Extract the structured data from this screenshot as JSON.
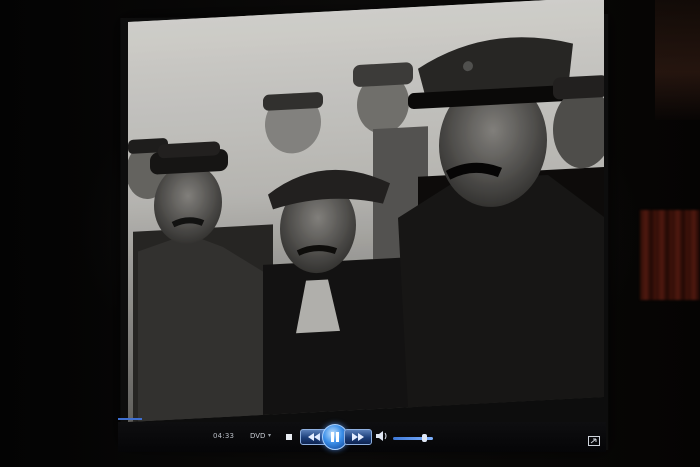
{
  "player": {
    "elapsed_time": "04:33",
    "source_label": "DVD",
    "seek_progress": 0.05,
    "volume_level": 0.8,
    "playback_state": "playing",
    "controls": {
      "stop_icon": "stop-icon",
      "previous_icon": "skip-previous-icon",
      "play_pause_icon": "pause-icon",
      "next_icon": "skip-next-icon",
      "volume_icon": "speaker-icon",
      "fullscreen_icon": "fullscreen-icon",
      "close_icon": "close-icon"
    },
    "colors": {
      "accent": "#3a8ee8",
      "control_bar": "#050507"
    }
  }
}
